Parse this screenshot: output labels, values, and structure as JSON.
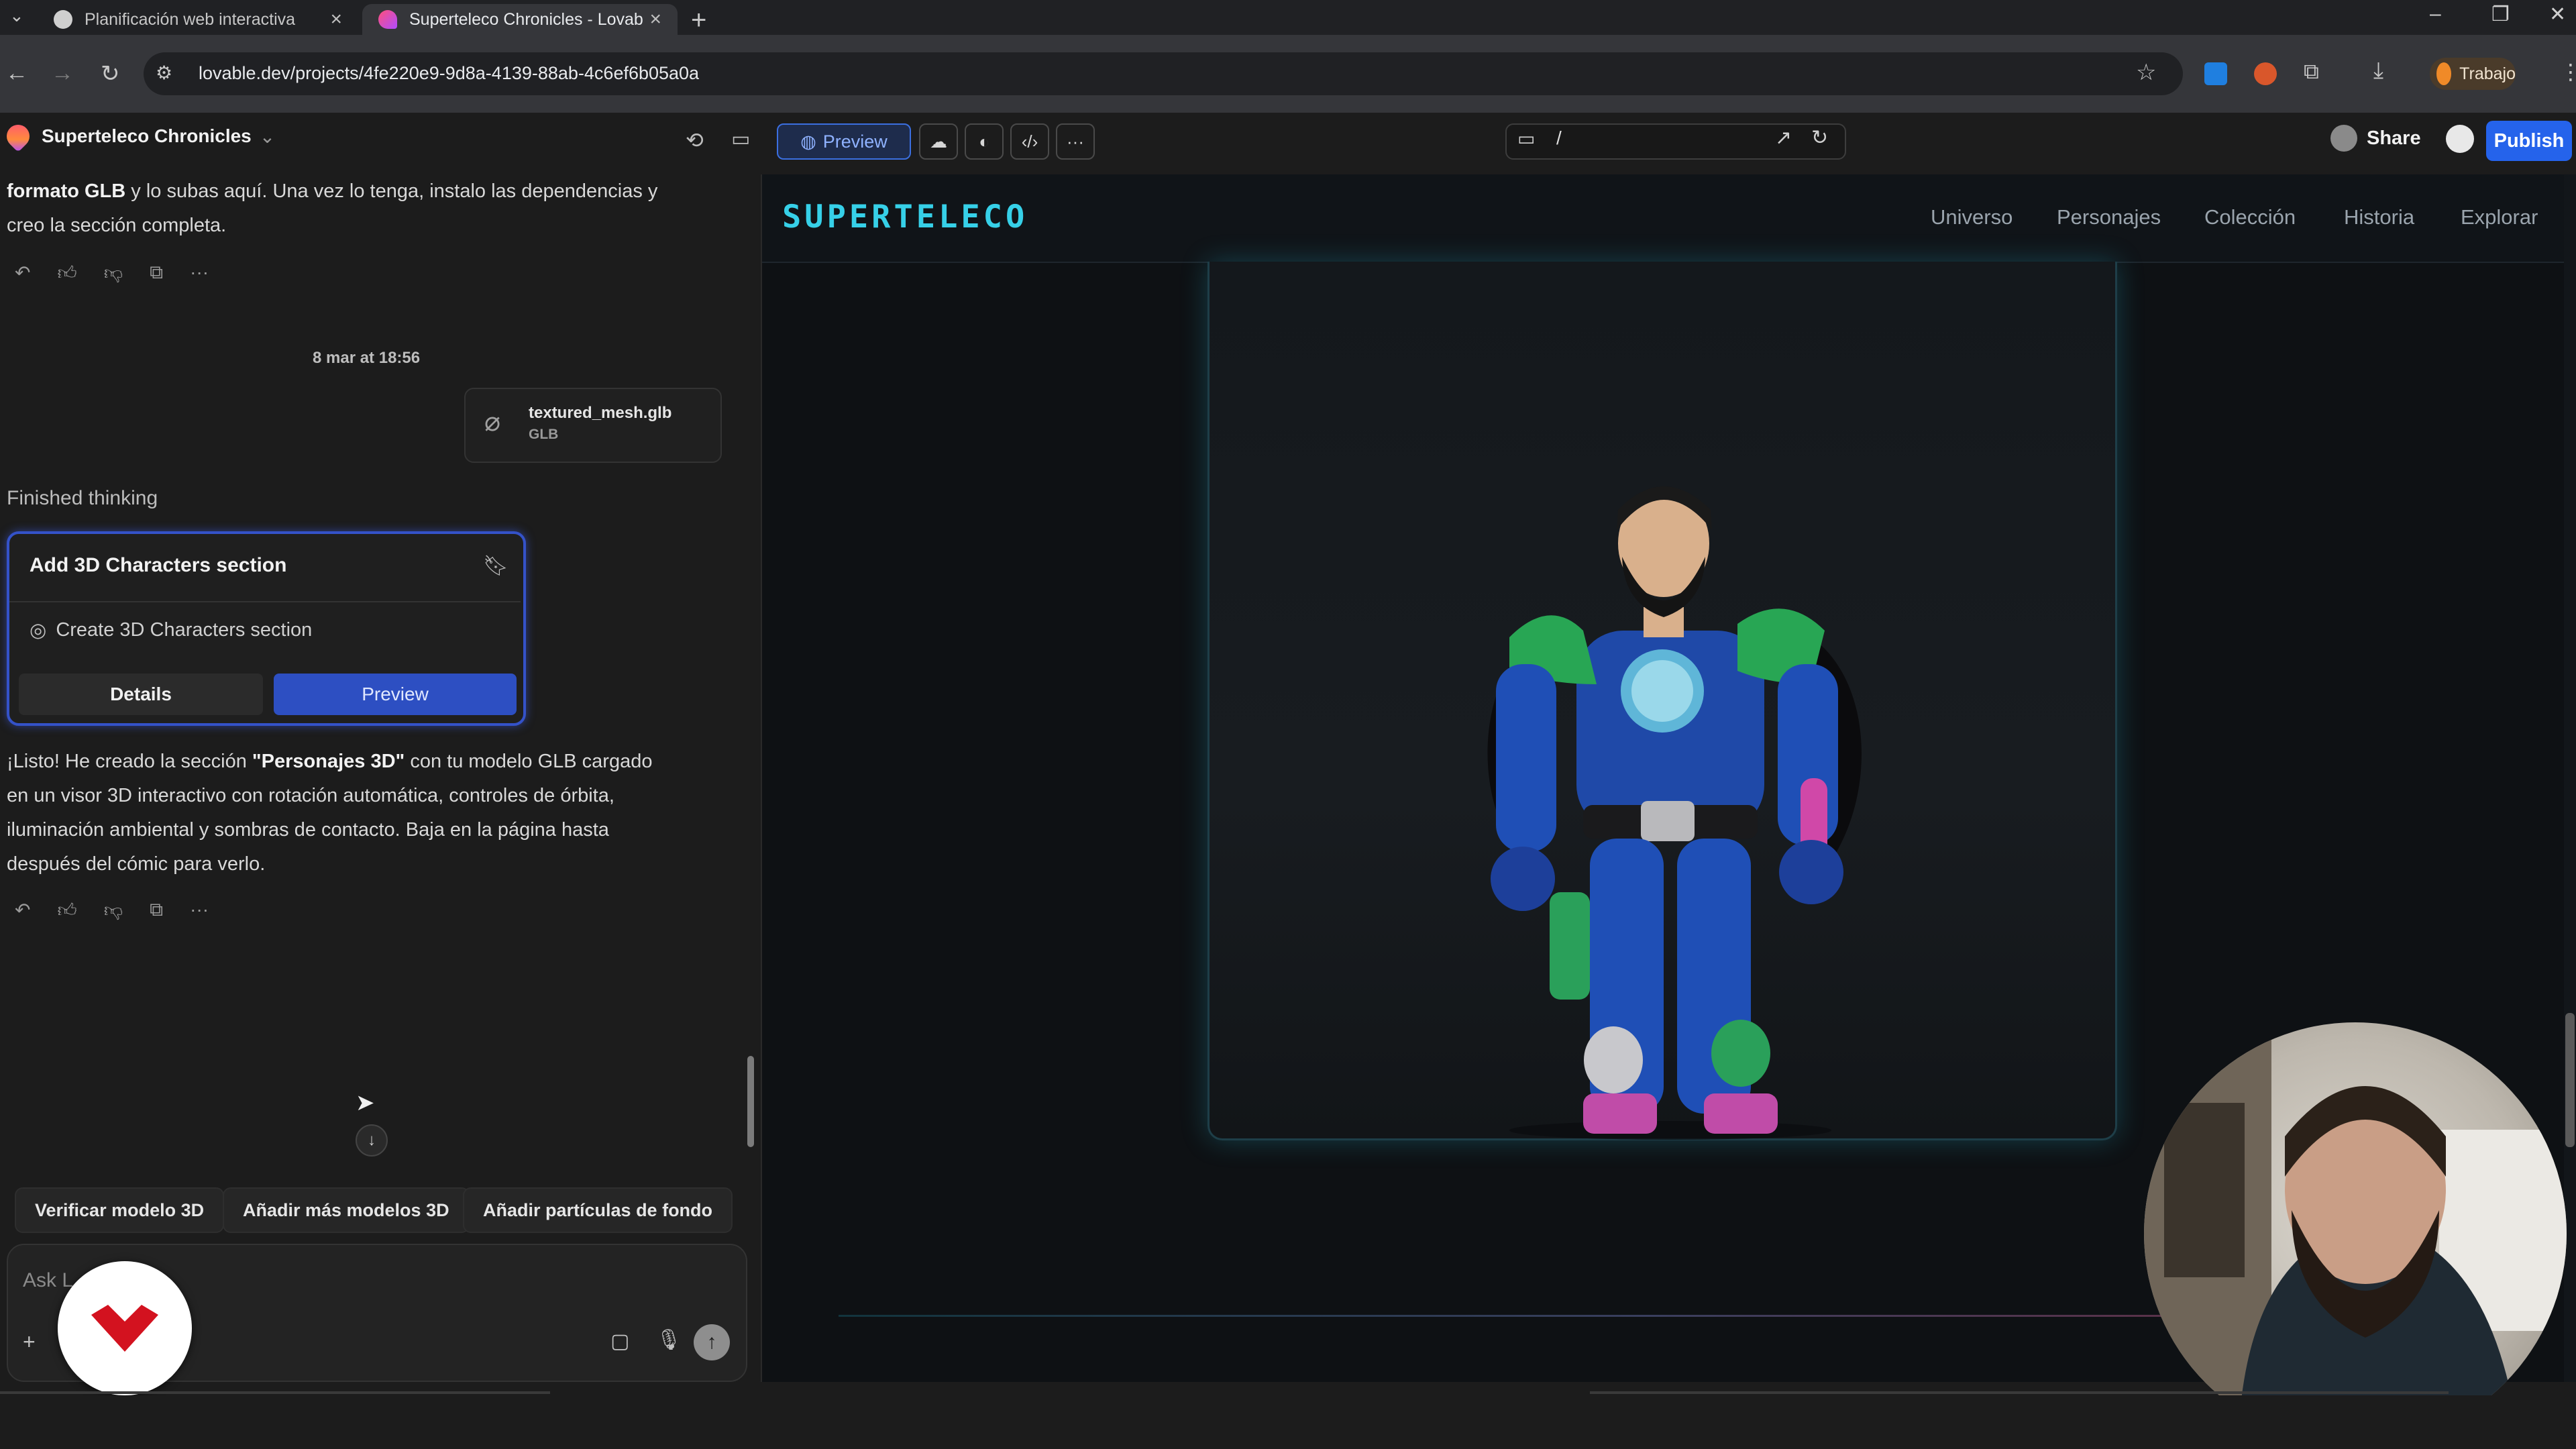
{
  "browser": {
    "tabs": [
      {
        "title": "Planificación web interactiva"
      },
      {
        "title": "Superteleco Chronicles - Lovab"
      }
    ],
    "url": "lovable.dev/projects/4fe220e9-9d8a-4139-88ab-4c6ef6b05a0a",
    "profile_label": "Trabajo"
  },
  "app": {
    "project_name": "Superteleco Chronicles",
    "preview_label": "Preview",
    "route": "/",
    "share_label": "Share",
    "publish_label": "Publish"
  },
  "chat": {
    "intro_bold": "formato GLB",
    "intro_rest_1": " y lo subas aquí. Una vez lo tenga, instalo las dependencias y",
    "intro_rest_2": "creo la sección completa.",
    "date": "8 mar at 18:56",
    "attachment": {
      "name": "textured_mesh.glb",
      "type": "GLB"
    },
    "thinking_status": "Finished thinking",
    "card": {
      "title": "Add 3D Characters section",
      "step": "Create 3D Characters section",
      "details_label": "Details",
      "preview_label": "Preview"
    },
    "reply_1_pre": "¡Listo! He creado la sección ",
    "reply_1_bold": "\"Personajes 3D\"",
    "reply_1_post": " con tu modelo GLB cargado",
    "reply_2": "en un visor 3D interactivo con rotación automática, controles de órbita,",
    "reply_3": "iluminación ambiental y sombras de contacto. Baja en la página hasta",
    "reply_4": "después del cómic para verlo.",
    "suggestions": [
      "Verificar modelo 3D",
      "Añadir más modelos 3D",
      "Añadir partículas de fondo"
    ],
    "input_placeholder": "Ask L"
  },
  "site": {
    "logo": "SUPERTELECO",
    "nav": [
      "Universo",
      "Personajes",
      "Colección",
      "Historia",
      "Explorar"
    ]
  },
  "colors": {
    "accent_blue": "#2563eb",
    "logo_cyan": "#36d0e8",
    "card_border": "#3452c9"
  }
}
